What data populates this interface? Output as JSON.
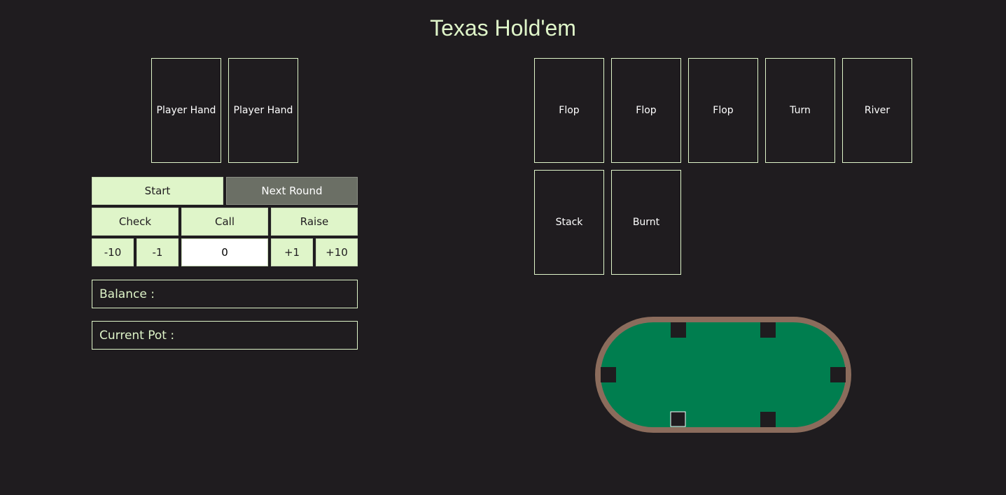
{
  "title": "Texas Hold'em",
  "player_hand": [
    "Player Hand",
    "Player Hand"
  ],
  "board": {
    "flop": [
      "Flop",
      "Flop",
      "Flop"
    ],
    "turn": "Turn",
    "river": "River",
    "stack": "Stack",
    "burnt": "Burnt"
  },
  "controls": {
    "start": "Start",
    "next_round": "Next Round",
    "check": "Check",
    "call": "Call",
    "raise": "Raise",
    "minus_ten": "-10",
    "minus_one": "-1",
    "amount": "0",
    "plus_one": "+1",
    "plus_ten": "+10"
  },
  "info": {
    "balance_label": "Balance :",
    "pot_label": "Current Pot :"
  },
  "colors": {
    "background": "#1f1c1f",
    "accent": "#dff5c9",
    "table_felt": "#007e4f",
    "table_rim": "#8b6c5c"
  }
}
